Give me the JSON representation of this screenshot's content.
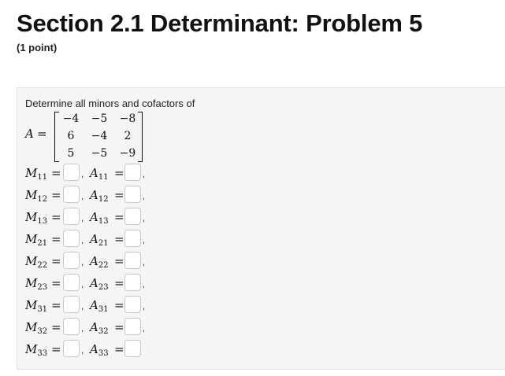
{
  "header": {
    "title": "Section 2.1 Determinant: Problem 5",
    "points": "(1 point)"
  },
  "problem": {
    "prompt": "Determine all minors and cofactors of",
    "matrix_name": "A",
    "equals": "=",
    "matrix": [
      [
        "−4",
        "−5",
        "−8"
      ],
      [
        "6",
        "−4",
        "2"
      ],
      [
        "5",
        "−5",
        "−9"
      ]
    ]
  },
  "answers": [
    {
      "minor": "M",
      "minor_sub": "11",
      "cofactor": "A",
      "cofactor_sub": "11",
      "minor_value": "",
      "cofactor_value": ""
    },
    {
      "minor": "M",
      "minor_sub": "12",
      "cofactor": "A",
      "cofactor_sub": "12",
      "minor_value": "",
      "cofactor_value": ""
    },
    {
      "minor": "M",
      "minor_sub": "13",
      "cofactor": "A",
      "cofactor_sub": "13",
      "minor_value": "",
      "cofactor_value": ""
    },
    {
      "minor": "M",
      "minor_sub": "21",
      "cofactor": "A",
      "cofactor_sub": "21",
      "minor_value": "",
      "cofactor_value": ""
    },
    {
      "minor": "M",
      "minor_sub": "22",
      "cofactor": "A",
      "cofactor_sub": "22",
      "minor_value": "",
      "cofactor_value": ""
    },
    {
      "minor": "M",
      "minor_sub": "23",
      "cofactor": "A",
      "cofactor_sub": "23",
      "minor_value": "",
      "cofactor_value": ""
    },
    {
      "minor": "M",
      "minor_sub": "31",
      "cofactor": "A",
      "cofactor_sub": "31",
      "minor_value": "",
      "cofactor_value": ""
    },
    {
      "minor": "M",
      "minor_sub": "32",
      "cofactor": "A",
      "cofactor_sub": "32",
      "minor_value": "",
      "cofactor_value": ""
    },
    {
      "minor": "M",
      "minor_sub": "33",
      "cofactor": "A",
      "cofactor_sub": "33",
      "minor_value": "",
      "cofactor_value": ""
    }
  ],
  "separator": ","
}
